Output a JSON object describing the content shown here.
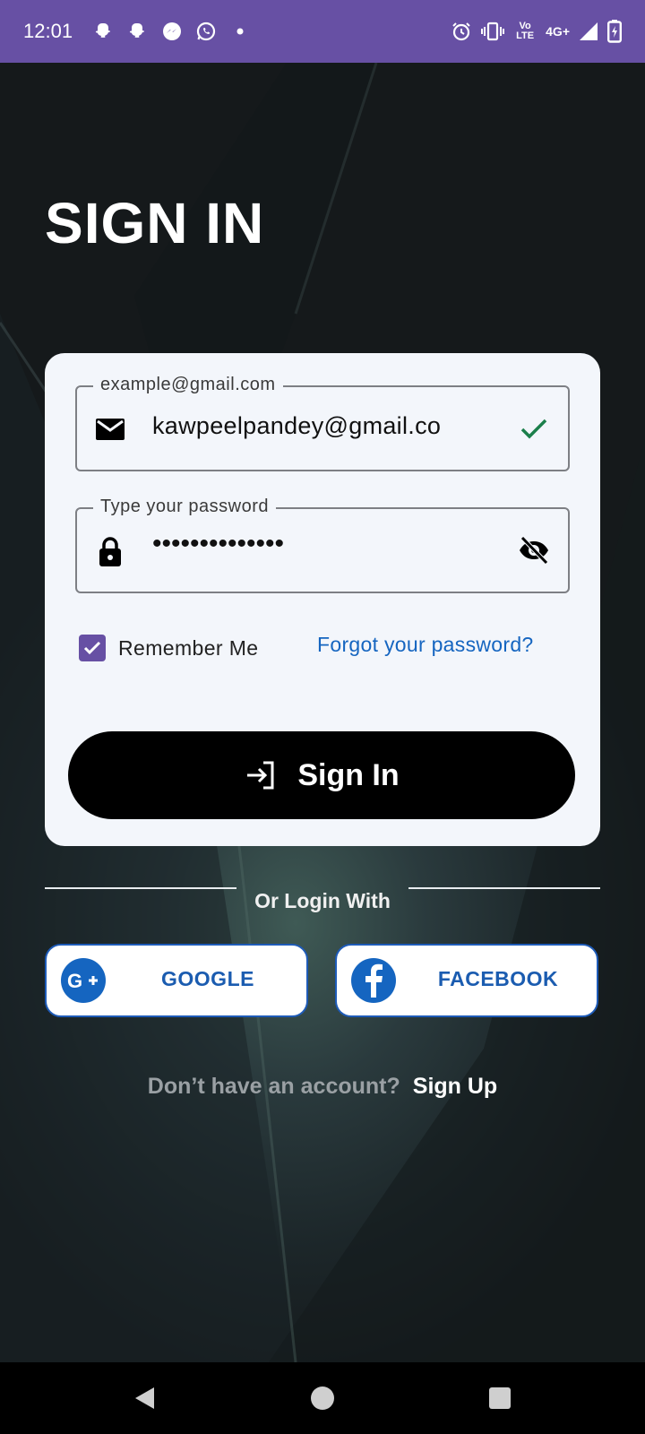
{
  "status_bar": {
    "time": "12:01",
    "left_icons": [
      "snapchat-icon",
      "snapchat-icon",
      "messenger-icon",
      "whatsapp-icon",
      "dot-icon"
    ],
    "right_icons": [
      "alarm-icon",
      "vibrate-icon",
      "volte-icon",
      "signal-icon",
      "battery-charging-icon"
    ],
    "network_volte": "Vo LTE",
    "network_type": "4G+"
  },
  "page": {
    "title": "SIGN IN"
  },
  "form": {
    "email": {
      "label": "example@gmail.com",
      "value": "kawpeelpandey@gmail.co",
      "icon": "mail-icon",
      "status_icon": "check-icon"
    },
    "password": {
      "label": "Type your password",
      "value": "••••••••••••••",
      "icon": "lock-icon",
      "toggle_icon": "eye-off-icon"
    },
    "remember_me": {
      "label": "Remember Me",
      "checked": true
    },
    "forgot_label": "Forgot your password?",
    "submit_label": "Sign In"
  },
  "social": {
    "divider_text": "Or Login With",
    "google_label": "GOOGLE",
    "facebook_label": "FACEBOOK"
  },
  "signup": {
    "question": "Don’t have an account?",
    "link_label": "Sign Up"
  },
  "colors": {
    "status_bar": "#6750a4",
    "accent_purple": "#6750a4",
    "link_blue": "#1565c0",
    "check_green": "#1b7f4b",
    "button_black": "#000000"
  }
}
